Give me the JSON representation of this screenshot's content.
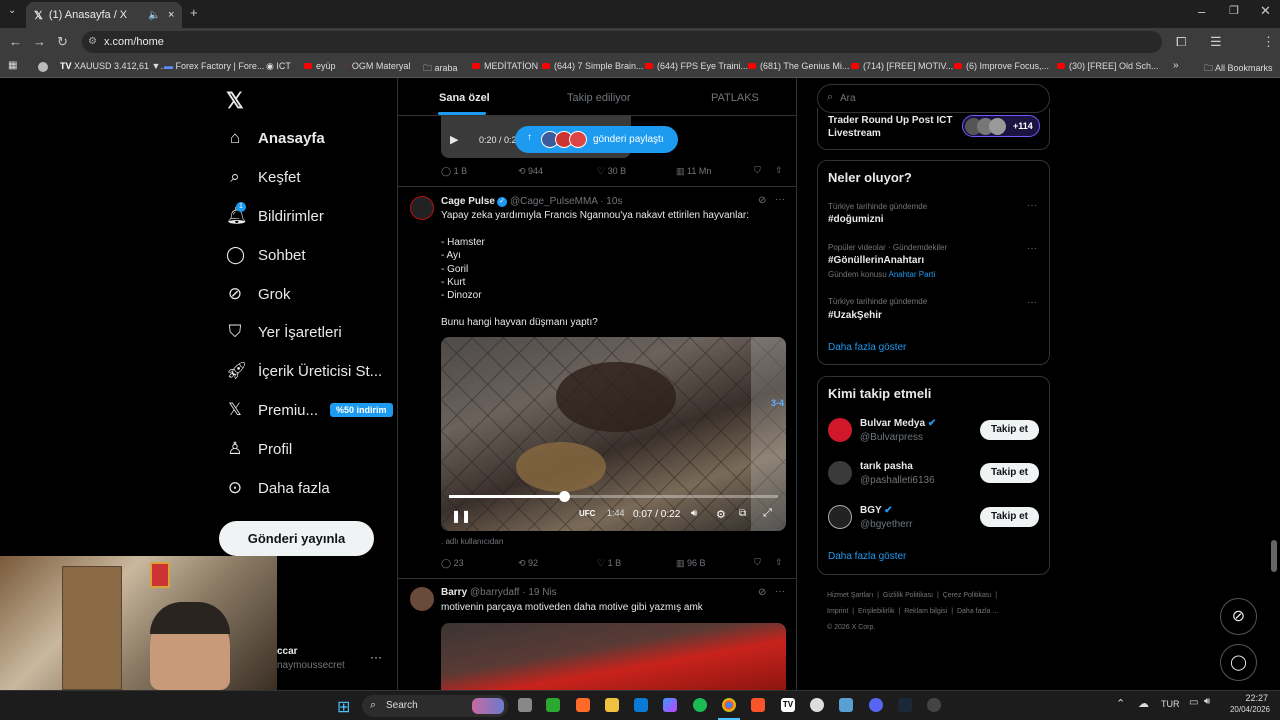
{
  "browser": {
    "tab_title": "(1) Anasayfa / X",
    "url": "x.com/home",
    "bookmarks": [
      "XAUUSD 3.412,61 ▼...",
      "Forex Factory | Fore...",
      "ICT",
      "eyüp",
      "OGM Materyal",
      "araba",
      "MEDİTATİON",
      "(644) 7 Simple Brain...",
      "(644) FPS Eye Traini...",
      "(681) The Genius Mi...",
      "(714) [FREE] MOTIV...",
      "(6) Improve Focus,...",
      "(30) [FREE] Old Sch..."
    ],
    "all_bookmarks": "All Bookmarks",
    "more_bookmarks": "»"
  },
  "nav": {
    "items": [
      {
        "label": "Anasayfa",
        "icon": "home-icon"
      },
      {
        "label": "Keşfet",
        "icon": "search-icon"
      },
      {
        "label": "Bildirimler",
        "icon": "bell-icon"
      },
      {
        "label": "Sohbet",
        "icon": "chat-icon"
      },
      {
        "label": "Grok",
        "icon": "grok-icon"
      },
      {
        "label": "Yer İşaretleri",
        "icon": "bookmark-icon"
      },
      {
        "label": "İçerik Üreticisi St...",
        "icon": "rocket-icon"
      },
      {
        "label": "Premiu...",
        "icon": "x-icon"
      },
      {
        "label": "Profil",
        "icon": "profile-icon"
      },
      {
        "label": "Daha fazla",
        "icon": "more-icon"
      }
    ],
    "premium_badge": "%50 indirim",
    "notification_count": "1",
    "post_button": "Gönderi yayınla",
    "account_name": "ccar",
    "account_handle": "naymoussecret"
  },
  "feed": {
    "tabs": [
      "Sana özel",
      "Takip ediliyor",
      "PATLAKS"
    ],
    "share_pill": "gönderi paylaştı",
    "video1_time": "0:20 / 0:2",
    "post1_stats": {
      "replies": "1 B",
      "reposts": "944",
      "likes": "30 B",
      "views": "11 Mn"
    },
    "post2": {
      "name": "Cage Pulse",
      "handle": "@Cage_PulseMMA · 10s",
      "lines": [
        "Yapay zeka yardımıyla Francis Ngannou'ya nakavt ettirilen hayvanlar:",
        "",
        "- Hamster",
        "- Ayı",
        "- Goril",
        "- Kurt",
        "- Dinozor",
        "",
        "Bunu hangi hayvan düşmanı yaptı?"
      ],
      "video_time": "0:07 / 0:22",
      "video_clock": "1:44",
      "video_corner": "3-4",
      "video_progress": 0.35,
      "attribution": ". adlı kullanıcıdan",
      "stats": {
        "replies": "23",
        "reposts": "92",
        "likes": "1 B",
        "views": "96 B"
      }
    },
    "post3": {
      "name": "Barry",
      "handle": "@barrydaff · 19 Nis",
      "text": "motivenin parçaya motiveden daha motive gibi yazmış amk"
    }
  },
  "right": {
    "search_placeholder": "Ara",
    "live_title": "Trader Round Up Post ICT Livestream",
    "live_count": "+114",
    "trends_title": "Neler oluyor?",
    "trends": [
      {
        "meta": "Türkiye tarihinde gündemde",
        "tag": "#doğumizni",
        "sub": ""
      },
      {
        "meta": "Popüler videolar · Gündemdekiler",
        "tag": "#GönüllerinAnahtarı",
        "sub": "Gündem konusu",
        "link": "Anahtar Parti"
      },
      {
        "meta": "Türkiye tarihinde gündemde",
        "tag": "#UzakŞehir",
        "sub": ""
      }
    ],
    "show_more": "Daha fazla göster",
    "who_title": "Kimi takip etmeli",
    "who": [
      {
        "name": "Bulvar Medya",
        "handle": "@Bulvarpress"
      },
      {
        "name": "tarık pasha",
        "handle": "@pashalleti6136"
      },
      {
        "name": "BGY",
        "handle": "@bgyetherr"
      }
    ],
    "follow_label": "Takip et",
    "footer": [
      "Hizmet Şartları",
      "Gizlilik Politikası",
      "Çerez Politikası",
      "Imprint",
      "Erişilebilirlik",
      "Reklam bilgisi",
      "Daha fazla ...",
      "© 2026 X Corp."
    ]
  },
  "taskbar": {
    "search": "Search",
    "lang": "TUR",
    "time": "22:27",
    "date": "20/04/2026"
  }
}
